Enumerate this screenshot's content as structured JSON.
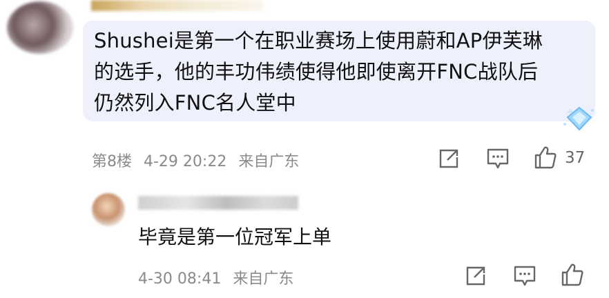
{
  "comment": {
    "text_lines": [
      "Shushei是第一个在职业赛场上使用蔚和AP伊芙琳",
      "的选手，他的丰功伟绩使得他即使离开FNC战队后",
      "仍然列入FNC名人堂中"
    ],
    "floor": "第8楼",
    "time": "4-29 20:22",
    "location": "来自广东",
    "likes": "37"
  },
  "reply": {
    "text": "毕竟是第一位冠军上单",
    "time": "4-30 08:41",
    "location": "来自广东"
  },
  "icons": {
    "share": "share-icon",
    "reply": "comment-icon",
    "like": "thumbs-up-icon",
    "badge": "diamond-badge-icon"
  },
  "colors": {
    "bubble": "#eef0fb",
    "meta_text": "#8a8a8a",
    "icon_stroke": "#666666"
  }
}
